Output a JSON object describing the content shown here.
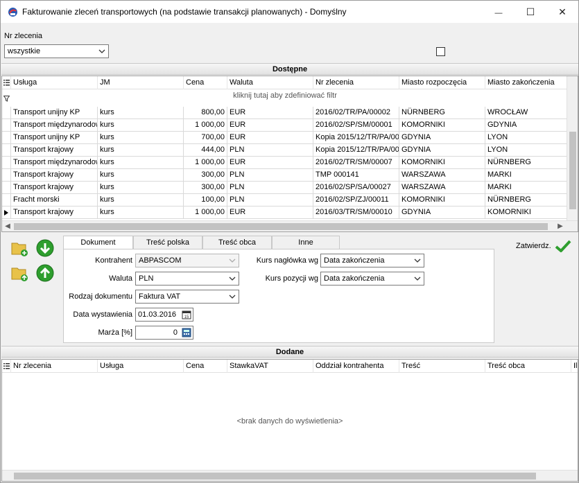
{
  "window": {
    "title": "Fakturowanie zleceń transportowych (na podstawie transakcji planowanych) - Domyślny",
    "minimize": "—",
    "maximize": "☐",
    "close": "✕"
  },
  "filter": {
    "label": "Nr zlecenia",
    "value": "wszystkie"
  },
  "available": {
    "title": "Dostępne",
    "filter_hint": "kliknij tutaj aby zdefiniować filtr",
    "columns": [
      "Usługa",
      "JM",
      "Cena",
      "Waluta",
      "Nr zlecenia",
      "Miasto rozpoczęcia",
      "Miasto zakończenia"
    ],
    "rows": [
      [
        "Transport unijny KP",
        "kurs",
        "800,00",
        "EUR",
        "2016/02/TR/PA/00002",
        "NÜRNBERG",
        "WROCŁAW"
      ],
      [
        "Transport międzynarodowy",
        "kurs",
        "1 000,00",
        "EUR",
        "2016/02/SP/SM/00001",
        "KOMORNIKI",
        "GDYNIA"
      ],
      [
        "Transport unijny KP",
        "kurs",
        "700,00",
        "EUR",
        "Kopia 2015/12/TR/PA/00",
        "GDYNIA",
        "LYON"
      ],
      [
        "Transport krajowy",
        "kurs",
        "444,00",
        "PLN",
        "Kopia 2015/12/TR/PA/00",
        "GDYNIA",
        "LYON"
      ],
      [
        "Transport międzynarodowy",
        "kurs",
        "1 000,00",
        "EUR",
        "2016/02/TR/SM/00007",
        "KOMORNIKI",
        "NÜRNBERG"
      ],
      [
        "Transport krajowy",
        "kurs",
        "300,00",
        "PLN",
        "TMP 000141",
        "WARSZAWA",
        "MARKI"
      ],
      [
        "Transport krajowy",
        "kurs",
        "300,00",
        "PLN",
        "2016/02/SP/SA/00027",
        "WARSZAWA",
        "MARKI"
      ],
      [
        "Fracht morski",
        "kurs",
        "100,00",
        "PLN",
        "2016/02/SP/ZJ/00011",
        "KOMORNIKI",
        "NÜRNBERG"
      ],
      [
        "Transport krajowy",
        "kurs",
        "1 000,00",
        "EUR",
        "2016/03/TR/SM/00010",
        "GDYNIA",
        "KOMORNIKI"
      ]
    ]
  },
  "tabs": [
    "Dokument",
    "Treść polska",
    "Treść obca",
    "Inne"
  ],
  "document": {
    "contractor_label": "Kontrahent",
    "contractor_value": "ABPASCOM",
    "currency_label": "Waluta",
    "currency_value": "PLN",
    "doc_type_label": "Rodzaj dokumentu",
    "doc_type_value": "Faktura VAT",
    "issue_date_label": "Data wystawienia",
    "issue_date_value": "01.03.2016",
    "margin_label": "Marża [%]",
    "margin_value": "0",
    "header_rate_label": "Kurs nagłówka wg",
    "header_rate_value": "Data zakończenia",
    "item_rate_label": "Kurs pozycji wg",
    "item_rate_value": "Data zakończenia"
  },
  "confirm_label": "Zatwierdz.",
  "added": {
    "title": "Dodane",
    "columns": [
      "Nr zlecenia",
      "Usługa",
      "Cena",
      "StawkaVAT",
      "Oddział kontrahenta",
      "Treść",
      "Treść obca",
      "Ilo"
    ],
    "empty": "<brak danych do wyświetlenia>"
  },
  "colors": {
    "selection_marker": "#000000",
    "green_icon": "#2e9e2e",
    "folder_icon": "#e8c24a"
  }
}
